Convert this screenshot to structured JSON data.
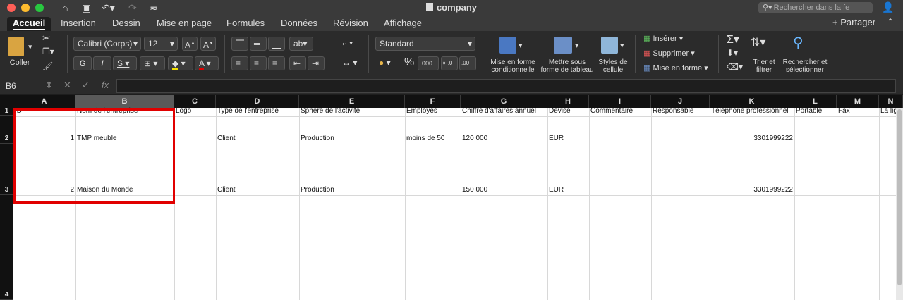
{
  "window": {
    "title": "company",
    "search_placeholder": "Rechercher dans la fe"
  },
  "tabs": [
    {
      "label": "Accueil",
      "active": true
    },
    {
      "label": "Insertion"
    },
    {
      "label": "Dessin"
    },
    {
      "label": "Mise en page"
    },
    {
      "label": "Formules"
    },
    {
      "label": "Données"
    },
    {
      "label": "Révision"
    },
    {
      "label": "Affichage"
    }
  ],
  "share_label": "Partager",
  "ribbon": {
    "paste_label": "Coller",
    "font_name": "Calibri (Corps)",
    "font_size": "12",
    "bold": "G",
    "italic": "I",
    "underline": "S",
    "number_format": "Standard",
    "percent": "%",
    "thousands": "000",
    "conditional_format_label": "Mise en forme conditionnelle",
    "format_table_label": "Mettre sous forme de tableau",
    "cell_styles_label": "Styles de cellule",
    "insert_label": "Insérer",
    "delete_label": "Supprimer",
    "format_label": "Mise en forme",
    "sort_filter_label": "Trier et filtrer",
    "find_select_label": "Rechercher et sélectionner"
  },
  "formula_bar": {
    "name_box": "B6",
    "fx": "fx",
    "formula": ""
  },
  "sheet": {
    "columns": [
      "A",
      "B",
      "C",
      "D",
      "E",
      "F",
      "G",
      "H",
      "I",
      "J",
      "K",
      "L",
      "M",
      "N"
    ],
    "selected_column": "B",
    "row_numbers": [
      "1",
      "2",
      "3",
      "4"
    ],
    "header_row": [
      "ID",
      "Nom de l'entreprise",
      "Logo",
      "Type de l'entreprise",
      "Sphère de l'activité",
      "Employés",
      "Chiffre d'affaires annuel",
      "Devise",
      "Commentaire",
      "Responsable",
      "Téléphone professionnel",
      "Portable",
      "Fax",
      "La ligne"
    ],
    "rows": [
      {
        "id": "1",
        "name": "TMP meuble",
        "type": "Client",
        "sphere": "Production",
        "employees": "moins de 50",
        "revenue": "120 000",
        "currency": "EUR",
        "phone": "3301999222"
      },
      {
        "id": "2",
        "name": "Maison du Monde",
        "type": "Client",
        "sphere": "Production",
        "employees": "",
        "revenue": "150 000",
        "currency": "EUR",
        "phone": "3301999222"
      }
    ]
  },
  "colors": {
    "highlight": "#e10000",
    "ribbon_bg": "#2b2b2b"
  }
}
